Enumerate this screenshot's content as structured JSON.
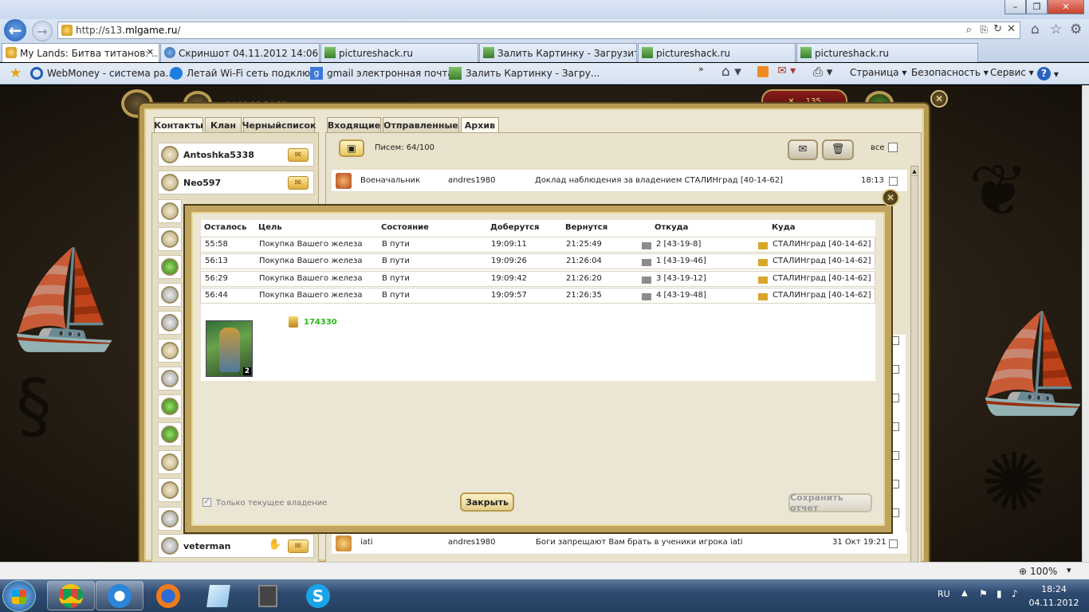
{
  "browser": {
    "url": "http://s13.mlgame.ru/",
    "url_prefix": "http://s13.",
    "url_domain": "mlgame.ru",
    "url_suffix": "/",
    "tabs": [
      {
        "label": "My Lands: Битва титанов: ...",
        "close": "✕",
        "active": true
      },
      {
        "label": "Скриншот 04.11.2012 14:06 :: f..."
      },
      {
        "label": "pictureshack.ru"
      },
      {
        "label": "Залить Картинку - Загрузить ..."
      },
      {
        "label": "pictureshack.ru"
      },
      {
        "label": "pictureshack.ru"
      }
    ],
    "favorites": [
      {
        "label": "WebMoney - система ра..."
      },
      {
        "label": "Летай  Wi-Fi сеть подклю..."
      },
      {
        "label": "gmail электронная почта..."
      },
      {
        "label": "Залить Картинку - Загру..."
      }
    ],
    "commands": {
      "page": "Страница",
      "safety": "Безопасность",
      "service": "Сервис",
      "help": "?"
    },
    "window_controls": {
      "minimize": "–",
      "maximize": "❐",
      "close": "✕"
    },
    "zoom": "100%"
  },
  "game": {
    "clock_partial": "04.11  18:24:52",
    "troops_count": "135",
    "contact_tabs": [
      "Контакты",
      "Клан",
      "Черныйсписок"
    ],
    "contacts": [
      {
        "name": "Antoshka5338"
      },
      {
        "name": "Neo597"
      },
      {
        "name": "veterman"
      }
    ],
    "mail_tabs": [
      "Входящие",
      "Отправленные",
      "Архив"
    ],
    "letters_label": "Писем:",
    "letters_count": "64/100",
    "all_label": "все",
    "messages": [
      {
        "sender": "Военачальник",
        "from": "andres1980",
        "subject": "Доклад наблюдения за владением СТАЛИНград [40-14-62]",
        "time": "18:13"
      },
      {
        "sender": "iati",
        "from": "andres1980",
        "subject": "Боги запрещают Вам брать в ученики игрока iati",
        "time": "31 Окт 19:21"
      }
    ]
  },
  "dialog": {
    "columns": [
      "Осталось",
      "Цель",
      "Состояние",
      "Доберутся",
      "Вернутся",
      "Откуда",
      "Куда"
    ],
    "rows": [
      {
        "left": "55:58",
        "target": "Покупка Вашего железа",
        "state": "В пути",
        "arrive": "19:09:11",
        "return": "21:25:49",
        "from": "2 [43-19-8]",
        "to": "СТАЛИНград [40-14-62]"
      },
      {
        "left": "56:13",
        "target": "Покупка Вашего железа",
        "state": "В пути",
        "arrive": "19:09:26",
        "return": "21:26:04",
        "from": "1 [43-19-46]",
        "to": "СТАЛИНград [40-14-62]"
      },
      {
        "left": "56:29",
        "target": "Покупка Вашего железа",
        "state": "В пути",
        "arrive": "19:09:42",
        "return": "21:26:20",
        "from": "3 [43-19-12]",
        "to": "СТАЛИНград [40-14-62]"
      },
      {
        "left": "56:44",
        "target": "Покупка Вашего железа",
        "state": "В пути",
        "arrive": "19:09:57",
        "return": "21:26:35",
        "from": "4 [43-19-48]",
        "to": "СТАЛИНград [40-14-62]"
      }
    ],
    "unit_count": "2",
    "gold_amount": "174330",
    "only_current_label": "Только текущее владение",
    "only_current_checked": true,
    "close_label": "Закрыть",
    "save_label": "Сохранить отчет"
  },
  "tray": {
    "lang": "RU",
    "time": "18:24",
    "date": "04.11.2012"
  },
  "colors": {
    "gold_text": "#2db51a",
    "frame": "#b79a52",
    "taskbar": "#2f4a70"
  }
}
